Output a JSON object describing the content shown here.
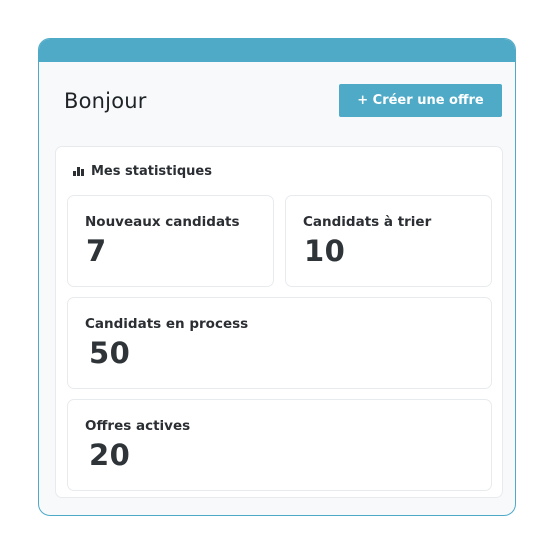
{
  "header": {
    "greeting": "Bonjour",
    "create_offer_label": "+ Créer une offre"
  },
  "stats": {
    "title": "Mes statistiques",
    "icon": "bar-chart-icon",
    "items": [
      {
        "label": "Nouveaux candidats",
        "value": "7"
      },
      {
        "label": "Candidats à trier",
        "value": "10"
      },
      {
        "label": "Candidats en process",
        "value": "50"
      },
      {
        "label": "Offres actives",
        "value": "20"
      }
    ]
  },
  "colors": {
    "accent": "#4eaac7",
    "text": "#2b2f33",
    "panel_border": "#e8ebee",
    "card_bg": "#f7f9fb"
  }
}
